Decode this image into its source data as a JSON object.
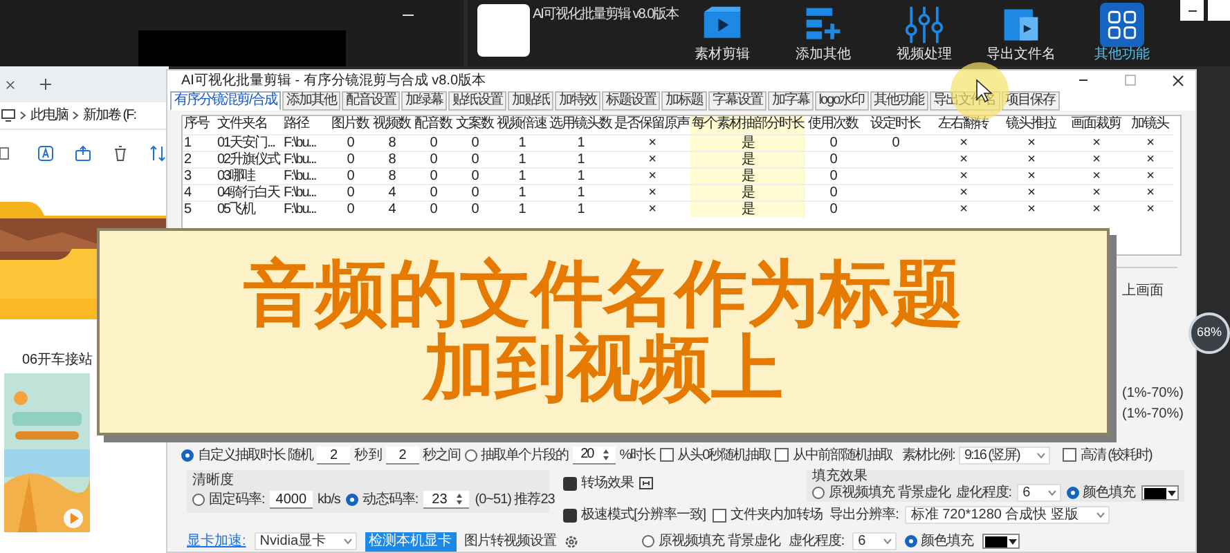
{
  "app_header": {
    "title": "AI可视化批量剪辑 v8.0版本",
    "toolbar": [
      {
        "label": "素材剪辑",
        "selected": false
      },
      {
        "label": "添加其他",
        "selected": false
      },
      {
        "label": "视频处理",
        "selected": false
      },
      {
        "label": "导出文件名",
        "selected": false
      },
      {
        "label": "其他功能",
        "selected": true
      }
    ]
  },
  "explorer": {
    "breadcrumb": [
      "此电脑",
      "新加卷 (F:"
    ],
    "folder_label": "06开车接站"
  },
  "dialog": {
    "title": "AI可视化批量剪辑 -  有序分镜混剪与合成  v8.0版本",
    "tabs": [
      {
        "label": "有序分镜混剪/合成",
        "selected": true
      },
      {
        "label": "添加其他",
        "selected": false
      },
      {
        "label": "配音设置",
        "selected": false
      },
      {
        "label": "加绿幕",
        "selected": false
      },
      {
        "label": "贴纸设置",
        "selected": false
      },
      {
        "label": "加贴纸",
        "selected": false
      },
      {
        "label": "加特效",
        "selected": false
      },
      {
        "label": "标题设置",
        "selected": false
      },
      {
        "label": "加标题",
        "selected": false
      },
      {
        "label": "字幕设置",
        "selected": false
      },
      {
        "label": "加字幕",
        "selected": false
      },
      {
        "label": "logo水印",
        "selected": false
      },
      {
        "label": "其他功能",
        "selected": false
      },
      {
        "label": "导出文件名",
        "selected": false
      },
      {
        "label": "项目保存",
        "selected": false
      }
    ],
    "table": {
      "columns": [
        {
          "label": "序号",
          "highlighted": false
        },
        {
          "label": "文件夹名",
          "highlighted": false
        },
        {
          "label": "路径",
          "highlighted": false
        },
        {
          "label": "图片数",
          "highlighted": false
        },
        {
          "label": "视频数",
          "highlighted": false
        },
        {
          "label": "配音数",
          "highlighted": false
        },
        {
          "label": "文案数",
          "highlighted": false
        },
        {
          "label": "视频倍速",
          "highlighted": false
        },
        {
          "label": "选用镜头数",
          "highlighted": false
        },
        {
          "label": "是否保留原声",
          "highlighted": false
        },
        {
          "label": "每个素材抽部分时长",
          "highlighted": true
        },
        {
          "label": "使用次数",
          "highlighted": false
        },
        {
          "label": "设定时长",
          "highlighted": false
        },
        {
          "label": "左右翻转",
          "highlighted": false
        },
        {
          "label": "镜头推拉",
          "highlighted": false
        },
        {
          "label": "画面裁剪",
          "highlighted": false
        },
        {
          "label": "加镜头",
          "highlighted": false
        }
      ],
      "rows": [
        [
          "1",
          "01天安门...",
          "F:\\bu...",
          "0",
          "8",
          "0",
          "0",
          "1",
          "1",
          "×",
          "是",
          "0",
          "0",
          "×",
          "×",
          "×",
          "×"
        ],
        [
          "2",
          "02升旗仪式",
          "F:\\bu...",
          "0",
          "8",
          "0",
          "0",
          "1",
          "1",
          "×",
          "是",
          "0",
          null,
          "×",
          "×",
          "×",
          "×"
        ],
        [
          "3",
          "03哪哇",
          "F:\\bu...",
          "0",
          "8",
          "0",
          "0",
          "1",
          "1",
          "×",
          "是",
          "0",
          null,
          "×",
          "×",
          "×",
          "×"
        ],
        [
          "4",
          "04骑行白天",
          "F:\\bu...",
          "0",
          "4",
          "0",
          "0",
          "1",
          "1",
          "×",
          "是",
          "0",
          null,
          "×",
          "×",
          "×",
          "×"
        ],
        [
          "5",
          "05飞机",
          "F:\\bu...",
          "0",
          "4",
          "0",
          "0",
          "1",
          "1",
          "×",
          "是",
          "0",
          null,
          "×",
          "×",
          "×",
          "×"
        ]
      ]
    },
    "side_texts": [
      "上画面",
      "(1%-70%)",
      "(1%-70%)"
    ],
    "row_1": [
      {
        "kind": "radio",
        "label": "自定义抽取时长 随机",
        "selected": true
      },
      {
        "kind": "input",
        "value": "2"
      },
      {
        "kind": "text",
        "label": "秒 到"
      },
      {
        "kind": "input",
        "value": "2"
      },
      {
        "kind": "text",
        "label": "秒之间"
      },
      {
        "kind": "radio",
        "label": "抽取单个片段的",
        "selected": false
      },
      {
        "kind": "spin",
        "value": "20"
      },
      {
        "kind": "text",
        "label": "%时长"
      },
      {
        "kind": "checkbox",
        "label": "从头0秒随机抽取",
        "checked": false
      },
      {
        "kind": "checkbox",
        "label": "从中前部随机抽取",
        "checked": false
      },
      {
        "kind": "text",
        "label": "素材比例:"
      },
      {
        "kind": "select",
        "value": "9:16 (竖屏)"
      },
      {
        "kind": "checkbox",
        "label": "高清 (较耗时)",
        "checked": false
      }
    ],
    "quality": {
      "title": "清晰度",
      "items": [
        {
          "kind": "radio",
          "label": "固定码率:",
          "selected": false
        },
        {
          "kind": "input",
          "value": "4000"
        },
        {
          "kind": "text",
          "label": "kb/s"
        },
        {
          "kind": "radio",
          "label": "动态码率:",
          "selected": true
        },
        {
          "kind": "spin",
          "value": "23"
        },
        {
          "kind": "text",
          "label": "(0~51) 推荐23"
        }
      ]
    },
    "middle_1": [
      {
        "kind": "checkbox",
        "label": "转场效果",
        "checked": true
      },
      {
        "kind": "icon"
      }
    ],
    "middle_2": [
      {
        "kind": "checkbox",
        "label": "极速模式[分辨率一致]",
        "checked": true
      },
      {
        "kind": "checkbox",
        "label": "文件夹内加转场",
        "checked": false
      },
      {
        "kind": "text",
        "label": "导出分辨率:"
      },
      {
        "kind": "select",
        "value": "标准 720*1280 合成快 竖版"
      }
    ],
    "fill": {
      "title": "填充效果",
      "items": [
        {
          "kind": "radio",
          "label": "原视频填充 背景虚化",
          "selected": false
        },
        {
          "kind": "text",
          "label": "虚化程度:"
        },
        {
          "kind": "select",
          "value": "6"
        },
        {
          "kind": "radio",
          "label": "颜色填充",
          "selected": true
        },
        {
          "kind": "color",
          "color": "#000000"
        }
      ]
    },
    "bottom_row": [
      {
        "kind": "link",
        "label": "显卡加速:"
      },
      {
        "kind": "select",
        "value": "Nvidia显卡"
      },
      {
        "kind": "button",
        "label": "检测本机显卡"
      },
      {
        "kind": "text",
        "label": "图片转视频设置"
      },
      {
        "kind": "gear"
      },
      {
        "kind": "radio",
        "label": "原视频填充 背景虚化",
        "selected": false
      },
      {
        "kind": "text",
        "label": "虚化程度:"
      },
      {
        "kind": "select",
        "value": "6"
      },
      {
        "kind": "radio",
        "label": "颜色填充",
        "selected": true
      },
      {
        "kind": "color",
        "color": "#000000"
      }
    ]
  },
  "banner": {
    "lines": [
      "音频的文件名作为标题",
      "加到视频上"
    ]
  },
  "progress_badge": "68%"
}
